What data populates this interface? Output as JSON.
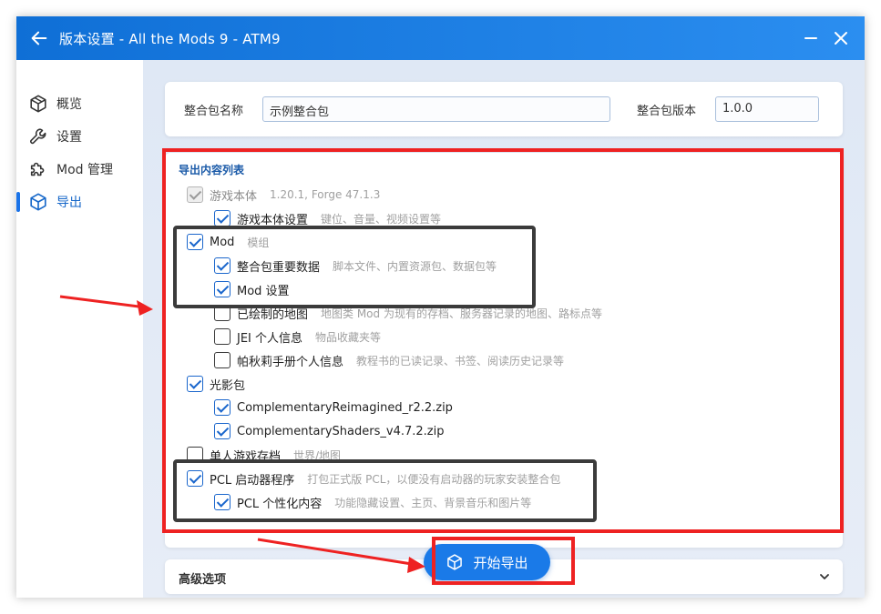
{
  "window": {
    "title": "版本设置 - All the Mods 9 - ATM9"
  },
  "sidebar": {
    "items": [
      {
        "label": "概览",
        "icon": "cube-outline-icon"
      },
      {
        "label": "设置",
        "icon": "wrench-icon"
      },
      {
        "label": "Mod 管理",
        "icon": "puzzle-icon"
      },
      {
        "label": "导出",
        "icon": "box-export-icon",
        "active": true
      }
    ]
  },
  "pack": {
    "name_label": "整合包名称",
    "name_value": "示例整合包",
    "version_label": "整合包版本",
    "version_value": "1.0.0"
  },
  "export_list": {
    "title": "导出内容列表",
    "items": [
      {
        "label": "游戏本体",
        "desc": "1.20.1, Forge 47.1.3",
        "checked": true,
        "disabled": true,
        "level": 0
      },
      {
        "label": "游戏本体设置",
        "desc": "键位、音量、视频设置等",
        "checked": true,
        "level": 1
      },
      {
        "label": "Mod",
        "desc": "模组",
        "checked": true,
        "level": 0
      },
      {
        "label": "整合包重要数据",
        "desc": "脚本文件、内置资源包、数据包等",
        "checked": true,
        "level": 1
      },
      {
        "label": "Mod 设置",
        "desc": "",
        "checked": true,
        "level": 1
      },
      {
        "label": "已绘制的地图",
        "desc": "地图类 Mod 为现有的存档、服务器记录的地图、路标点等",
        "checked": false,
        "level": 1
      },
      {
        "label": "JEI 个人信息",
        "desc": "物品收藏夹等",
        "checked": false,
        "level": 1
      },
      {
        "label": "帕秋莉手册个人信息",
        "desc": "教程书的已读记录、书签、阅读历史记录等",
        "checked": false,
        "level": 1
      },
      {
        "label": "光影包",
        "desc": "",
        "checked": true,
        "level": 0
      },
      {
        "label": "ComplementaryReimagined_r2.2.zip",
        "desc": "",
        "checked": true,
        "level": 1
      },
      {
        "label": "ComplementaryShaders_v4.7.2.zip",
        "desc": "",
        "checked": true,
        "level": 1
      },
      {
        "label": "单人游戏存档",
        "desc": "世界/地图",
        "checked": false,
        "level": 0
      },
      {
        "label": "PCL 启动器程序",
        "desc": "打包正式版 PCL，以便没有启动器的玩家安装整合包",
        "checked": true,
        "level": 0
      },
      {
        "label": "PCL 个性化内容",
        "desc": "功能隐藏设置、主页、背景音乐和图片等",
        "checked": true,
        "level": 1
      }
    ]
  },
  "advanced": {
    "label": "高级选项"
  },
  "export_button": {
    "label": "开始导出",
    "icon": "box-export-icon"
  },
  "colors": {
    "accent": "#1a7ae8",
    "annotation_red": "#ee2222",
    "annotation_dark": "#3b3b3b"
  }
}
